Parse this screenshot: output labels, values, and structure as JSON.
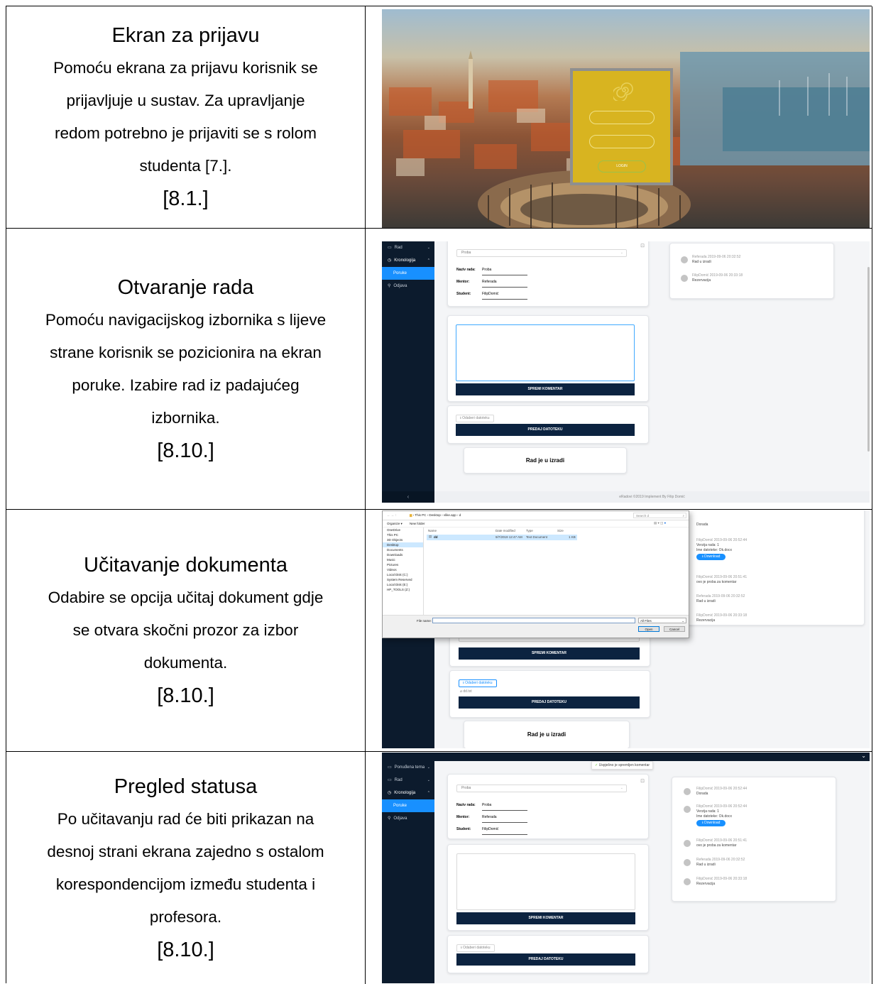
{
  "rows": [
    {
      "title": "Ekran za prijavu",
      "desc": [
        "Pomoću ekrana za prijavu korisnik se",
        "prijavljuje u sustav. Za upravljanje",
        "redom potrebno je prijaviti se s rolom",
        "studenta [7.]."
      ],
      "ref": "[8.1.]",
      "login": {
        "button": "LOGIN"
      }
    },
    {
      "title": "Otvaranje rada",
      "desc": [
        "Pomoću navigacijskog izbornika s lijeve",
        "strane korisnik se pozicionira na ekran",
        "poruke. Izabire rad iz padajućeg",
        "izbornika."
      ],
      "ref": "[8.10.]"
    },
    {
      "title": "Učitavanje dokumenta",
      "desc": [
        "Odabire se opcija učitaj dokument gdje",
        "se otvara skočni prozor za izbor",
        "dokumenta."
      ],
      "ref": "[8.10.]"
    },
    {
      "title": "Pregled statusa",
      "desc": [
        "Po učitavanju rad će biti prikazan na",
        "desnoj strani ekrana zajedno s ostalom",
        "korespondencijom između studenta i",
        "profesora."
      ],
      "ref": "[8.10.]"
    }
  ],
  "app": {
    "menu": {
      "rad": "Rad",
      "kronologija": "Kronologija",
      "poruke": "Poruke",
      "odjava": "Odjava",
      "ponudena": "Ponuđena tema"
    },
    "select_value": "Proba",
    "fields": {
      "naziv_label": "Naziv rada:",
      "naziv_value": "Proba",
      "mentor_label": "Mentor:",
      "mentor_value": "Referada",
      "student_label": "Student:",
      "student_value": "FilipDomić"
    },
    "save_comment": "SPREMI KOMENTAR",
    "choose_file": "Odaberi datoteku",
    "submit_file": "PREDAJ DATOTEKU",
    "status": "Rad je u izradi",
    "footer": "eRadovi ©2019 Implement By Filip Domić",
    "saved_toast": "Uspješno je spremljen komentar",
    "attached_file": "dd.txt",
    "messages_row2": [
      {
        "header": "Referada 2019-09-06 20:32:52",
        "text": "Rad u izradi"
      },
      {
        "header": "FilipDomić 2019-09-06 20:33:18",
        "text": "Rezervacija"
      }
    ],
    "messages_row4": [
      {
        "header": "FilipDomić 2019-09-06 20:52:44",
        "text": "Dorada"
      },
      {
        "header": "FilipDomić 2019-09-06 20:52:44",
        "text": "Verzija rada: 1",
        "text2": "Ime datoteke: Ok.docx",
        "download": "Download"
      },
      {
        "header": "FilipDomić 2019-09-06 20:51:41",
        "text": "ovo je proba za komentar"
      },
      {
        "header": "Referada 2019-09-06 20:32:52",
        "text": "Rad u izradi"
      },
      {
        "header": "FilipDomić 2019-09-06 20:33:18",
        "text": "Rezervacija"
      }
    ],
    "messages_row3": [
      {
        "text": "Dorada"
      },
      {
        "header": "FilipDomić 2019-09-06 20:52:44",
        "text": "Verzija rada: 1",
        "text2": "Ime datoteke: Ok.docx",
        "download": "Download"
      },
      {
        "header": "FilipDomić 2019-09-06 20:51:41",
        "text": "ovo je proba za komentar"
      },
      {
        "header": "Referada 2019-09-06 20:32:52",
        "text": "Rad u izradi"
      },
      {
        "header": "FilipDomić 2019-09-06 20:33:18",
        "text": "Rezervacija"
      }
    ]
  },
  "dialog": {
    "path": [
      "This PC",
      "Desktop",
      "vlike.app",
      "d"
    ],
    "search": "Search d",
    "organize": "Organize ▾",
    "new_folder": "New folder",
    "nav": [
      "OneDrive",
      "This PC",
      "3D Objects",
      "Desktop",
      "Documents",
      "Downloads",
      "Music",
      "Pictures",
      "Videos",
      "Local Disk (C:)",
      "System Reserved",
      "Local Disk (E:)",
      "HP_TOOLS (Z:)"
    ],
    "columns": [
      "Name",
      "Date modified",
      "Type",
      "Size"
    ],
    "file": {
      "name": "dd",
      "date": "9/7/2019 12:47 AM",
      "type": "Text Document",
      "size": "1 KB"
    },
    "file_name_label": "File name:",
    "file_type": "All Files",
    "open": "Open",
    "cancel": "Cancel"
  }
}
